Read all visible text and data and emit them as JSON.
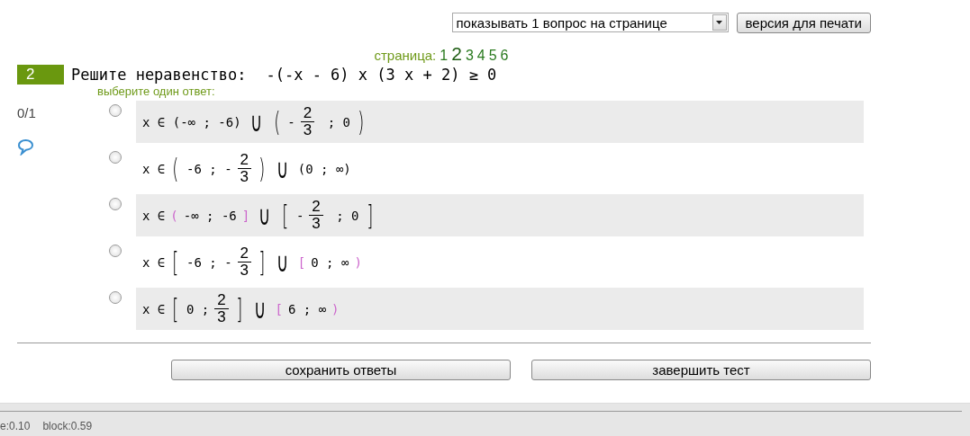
{
  "toolbar": {
    "per_page_select": "показывать 1 вопрос на странице",
    "print_button": "версия для печати"
  },
  "pagination": {
    "label": "страница:",
    "pages": [
      {
        "label": "1",
        "selected": false
      },
      {
        "label": "2",
        "selected": true
      },
      {
        "label": "3",
        "selected": false
      },
      {
        "label": "4",
        "selected": false
      },
      {
        "label": "5",
        "selected": false
      },
      {
        "label": "6",
        "selected": false
      }
    ]
  },
  "question": {
    "number": "2",
    "prompt": "Решите неравенство:",
    "expression": "-(-x - 6) x (3 x + 2) ≥ 0",
    "hint": "выберите один ответ:",
    "score": "0/1",
    "answers": [
      {
        "selected": false,
        "parts": [
          {
            "kind": "text",
            "text": "x ∈ (-∞ ; -6)"
          },
          {
            "kind": "big",
            "text": "∪"
          },
          {
            "kind": "big",
            "text": "("
          },
          {
            "kind": "text",
            "text": "-"
          },
          {
            "kind": "frac",
            "num": "2",
            "den": "3"
          },
          {
            "kind": "text",
            "text": " ; 0"
          },
          {
            "kind": "big",
            "text": ")"
          }
        ]
      },
      {
        "selected": false,
        "parts": [
          {
            "kind": "text",
            "text": "x ∈"
          },
          {
            "kind": "big",
            "text": "("
          },
          {
            "kind": "text",
            "text": "-6 ; -"
          },
          {
            "kind": "frac",
            "num": "2",
            "den": "3"
          },
          {
            "kind": "big",
            "text": ")"
          },
          {
            "kind": "big",
            "text": "∪"
          },
          {
            "kind": "text",
            "text": "(0 ; ∞)"
          }
        ]
      },
      {
        "selected": false,
        "parts": [
          {
            "kind": "text",
            "text": "x ∈"
          },
          {
            "kind": "text",
            "text": "(",
            "color": "#cc66cc"
          },
          {
            "kind": "text",
            "text": "-∞ ; -6"
          },
          {
            "kind": "text",
            "text": "]",
            "color": "#cc66cc"
          },
          {
            "kind": "big",
            "text": "∪"
          },
          {
            "kind": "big",
            "text": "["
          },
          {
            "kind": "text",
            "text": "-"
          },
          {
            "kind": "frac",
            "num": "2",
            "den": "3"
          },
          {
            "kind": "text",
            "text": " ; 0"
          },
          {
            "kind": "big",
            "text": "]"
          }
        ]
      },
      {
        "selected": false,
        "parts": [
          {
            "kind": "text",
            "text": "x ∈"
          },
          {
            "kind": "big",
            "text": "["
          },
          {
            "kind": "text",
            "text": "-6 ; -"
          },
          {
            "kind": "frac",
            "num": "2",
            "den": "3"
          },
          {
            "kind": "big",
            "text": "]"
          },
          {
            "kind": "big",
            "text": "∪"
          },
          {
            "kind": "text",
            "text": "[",
            "color": "#cc66cc"
          },
          {
            "kind": "text",
            "text": "0 ; ∞"
          },
          {
            "kind": "text",
            "text": ")",
            "color": "#cc66cc"
          }
        ]
      },
      {
        "selected": false,
        "parts": [
          {
            "kind": "text",
            "text": "x ∈"
          },
          {
            "kind": "big",
            "text": "["
          },
          {
            "kind": "text",
            "text": "0 ;"
          },
          {
            "kind": "frac",
            "num": "2",
            "den": "3"
          },
          {
            "kind": "big",
            "text": "]"
          },
          {
            "kind": "big",
            "text": "∪"
          },
          {
            "kind": "text",
            "text": "[",
            "color": "#cc66cc"
          },
          {
            "kind": "text",
            "text": "6 ; ∞"
          },
          {
            "kind": "text",
            "text": ")",
            "color": "#cc66cc"
          }
        ]
      }
    ]
  },
  "actions": [
    "сохранить ответы",
    "завершить тест"
  ],
  "status_bar": [
    "e:0.10",
    "block:0.59"
  ]
}
